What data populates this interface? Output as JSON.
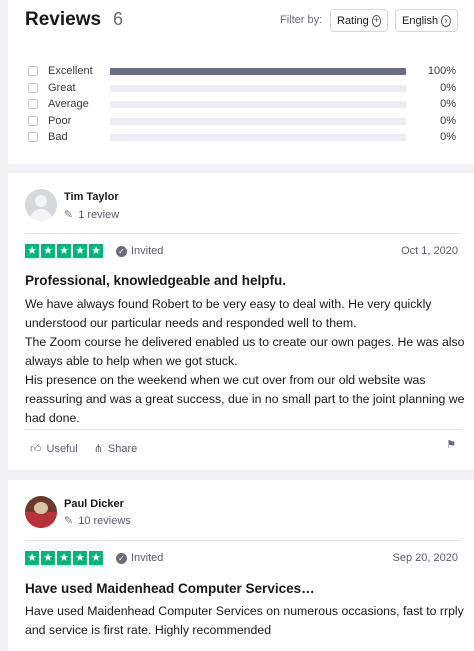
{
  "summary": {
    "title": "Reviews",
    "count": "6",
    "filter_label": "Filter by:",
    "rating_button": "Rating",
    "language_button": "English",
    "distribution": [
      {
        "label": "Excellent",
        "percent_text": "100%",
        "fraction": 1.0
      },
      {
        "label": "Great",
        "percent_text": "0%",
        "fraction": 0
      },
      {
        "label": "Average",
        "percent_text": "0%",
        "fraction": 0
      },
      {
        "label": "Poor",
        "percent_text": "0%",
        "fraction": 0
      },
      {
        "label": "Bad",
        "percent_text": "0%",
        "fraction": 0
      }
    ],
    "bar_fill_color": "#6c6c85"
  },
  "reviews": [
    {
      "name": "Tim Taylor",
      "review_count": "1 review",
      "rating": 5,
      "status": "Invited",
      "date": "Oct 1, 2020",
      "title": "Professional, knowledgeable and helpfu.",
      "body": "We have always found Robert to be very easy to deal with. He very quickly understood our particular needs and responded well to them.\nThe Zoom course he delivered enabled us to create our own pages. He was also always able to help when we got stuck.\nHis presence on the weekend when we cut over from our old website was reassuring and was a great success, due in no small part to the joint planning we had done.",
      "useful_label": "Useful",
      "share_label": "Share"
    },
    {
      "name": "Paul Dicker",
      "review_count": "10 reviews",
      "rating": 5,
      "status": "Invited",
      "date": "Sep 20, 2020",
      "title": "Have used Maidenhead Computer Services…",
      "body": "Have used Maidenhead Computer Services on numerous occasions, fast to rrply and service is first rate. Highly recommended"
    }
  ],
  "colors": {
    "star_green": "#00b67a",
    "page_background": "#f1f1f6"
  }
}
